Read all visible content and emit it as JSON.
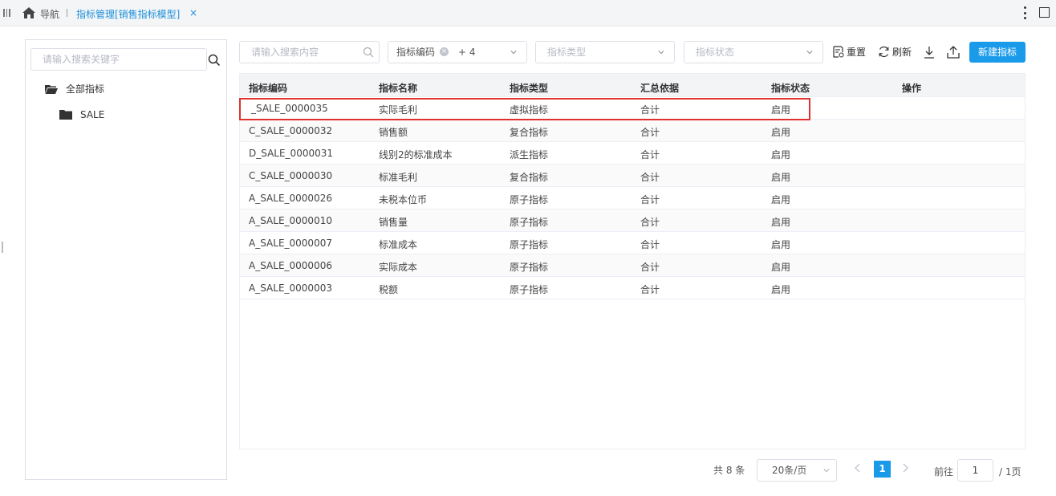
{
  "tabs": {
    "nav_label": "导航",
    "active_tab": "指标管理[销售指标模型]",
    "close_glyph": "×"
  },
  "sidebar": {
    "search_placeholder": "请输入搜索关键字",
    "root_label": "全部指标",
    "child_label": "SALE"
  },
  "toolbar": {
    "search_placeholder": "请输入搜索内容",
    "code_chip": "指标编码",
    "code_more": "+ 4",
    "type_placeholder": "指标类型",
    "status_placeholder": "指标状态",
    "reset_label": "重置",
    "refresh_label": "刷新",
    "new_label": "新建指标"
  },
  "table": {
    "headers": [
      "指标编码",
      "指标名称",
      "指标类型",
      "汇总依据",
      "指标状态",
      "操作"
    ],
    "rows": [
      {
        "code": "_SALE_0000035",
        "name": "实际毛利",
        "type": "虚拟指标",
        "agg": "合计",
        "status": "启用"
      },
      {
        "code": "C_SALE_0000032",
        "name": "销售额",
        "type": "复合指标",
        "agg": "合计",
        "status": "启用"
      },
      {
        "code": "D_SALE_0000031",
        "name": "线别2的标准成本",
        "type": "派生指标",
        "agg": "合计",
        "status": "启用"
      },
      {
        "code": "C_SALE_0000030",
        "name": "标准毛利",
        "type": "复合指标",
        "agg": "合计",
        "status": "启用"
      },
      {
        "code": "A_SALE_0000026",
        "name": "未税本位币",
        "type": "原子指标",
        "agg": "合计",
        "status": "启用"
      },
      {
        "code": "A_SALE_0000010",
        "name": "销售量",
        "type": "原子指标",
        "agg": "合计",
        "status": "启用"
      },
      {
        "code": "A_SALE_0000007",
        "name": "标准成本",
        "type": "原子指标",
        "agg": "合计",
        "status": "启用"
      },
      {
        "code": "A_SALE_0000006",
        "name": "实际成本",
        "type": "原子指标",
        "agg": "合计",
        "status": "启用"
      },
      {
        "code": "A_SALE_0000003",
        "name": "税额",
        "type": "原子指标",
        "agg": "合计",
        "status": "启用"
      }
    ]
  },
  "pagination": {
    "total": "共 8 条",
    "page_size": "20条/页",
    "current_page": "1",
    "goto_label": "前往",
    "goto_value": "1",
    "pages": "/ 1页"
  },
  "colors": {
    "accent": "#1a9bea",
    "highlight_border": "#e03131"
  }
}
